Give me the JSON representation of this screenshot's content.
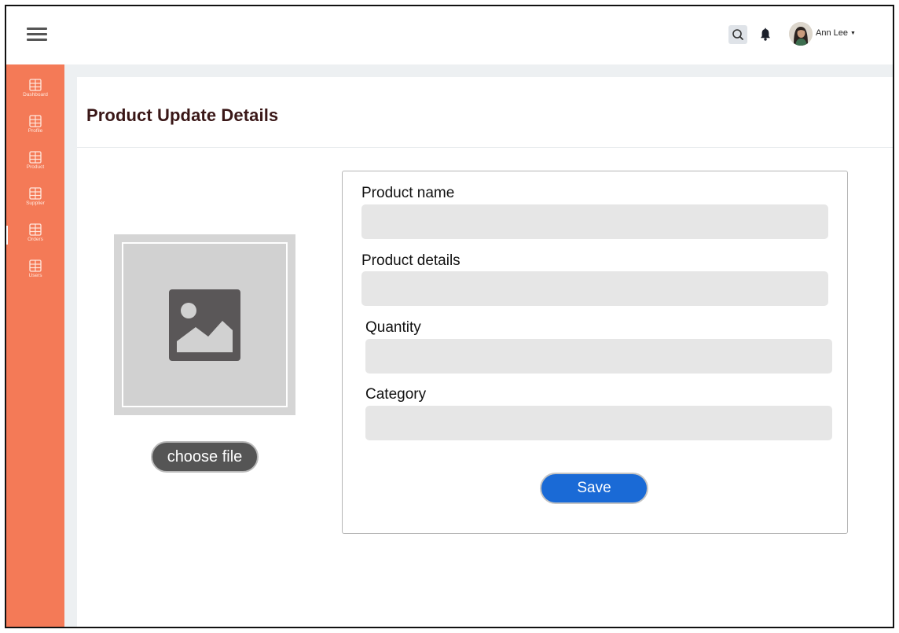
{
  "header": {
    "user_name": "Ann Lee",
    "user_menu_caret": "▼"
  },
  "sidebar": {
    "items": [
      {
        "label": "Dashboard",
        "icon": "grid-icon"
      },
      {
        "label": "Profile",
        "icon": "grid-icon"
      },
      {
        "label": "Product",
        "icon": "grid-icon"
      },
      {
        "label": "Supplier",
        "icon": "grid-icon"
      },
      {
        "label": "Orders",
        "icon": "grid-icon"
      },
      {
        "label": "Users",
        "icon": "grid-icon"
      }
    ]
  },
  "page": {
    "title": "Product Update Details"
  },
  "image_panel": {
    "placeholder_icon": "image-placeholder-icon",
    "choose_file_label": "choose file"
  },
  "form": {
    "fields": [
      {
        "label": "Product name",
        "value": ""
      },
      {
        "label": "Product details",
        "value": ""
      },
      {
        "label": "Quantity",
        "value": ""
      },
      {
        "label": "Category",
        "value": ""
      }
    ],
    "save_label": "Save"
  },
  "colors": {
    "sidebar": "#f47a57",
    "title": "#3a1717",
    "save_button": "#1a6ad6",
    "input_bg": "#e6e6e6",
    "choose_file_button": "#555555"
  }
}
